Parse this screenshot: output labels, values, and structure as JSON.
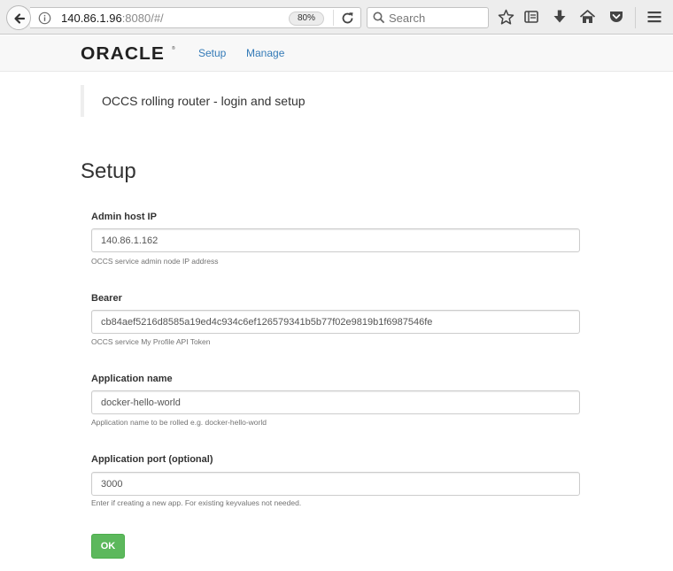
{
  "browser": {
    "url_host": "140.86.1.96",
    "url_rest": ":8080/#/",
    "zoom": "80%",
    "search_placeholder": "Search"
  },
  "navbar": {
    "brand": "ORACLE",
    "brand_mark": "®",
    "links": [
      "Setup",
      "Manage"
    ]
  },
  "intro": "OCCS rolling router - login and setup",
  "page_title": "Setup",
  "form": {
    "fields": [
      {
        "label": "Admin host IP",
        "value": "140.86.1.162",
        "help": "OCCS service admin node IP address"
      },
      {
        "label": "Bearer",
        "value": "cb84aef5216d8585a19ed4c934c6ef126579341b5b77f02e9819b1f6987546fe",
        "help": "OCCS service My Profile API Token"
      },
      {
        "label": "Application name",
        "value": "docker-hello-world",
        "help": "Application name to be rolled e.g. docker-hello-world"
      },
      {
        "label": "Application port (optional)",
        "value": "3000",
        "help": "Enter if creating a new app. For existing keyvalues not needed."
      }
    ],
    "submit_label": "OK"
  }
}
